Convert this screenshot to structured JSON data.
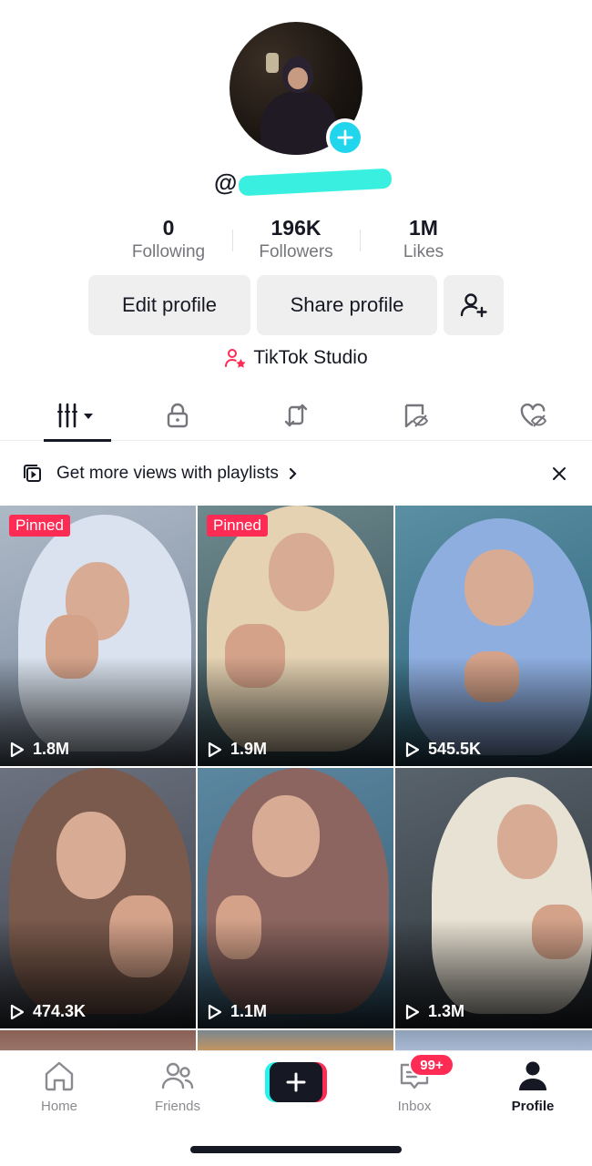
{
  "profile": {
    "username_prefix": "@",
    "stats": [
      {
        "value": "0",
        "label": "Following"
      },
      {
        "value": "196K",
        "label": "Followers"
      },
      {
        "value": "1M",
        "label": "Likes"
      }
    ],
    "edit_label": "Edit profile",
    "share_label": "Share profile",
    "studio_label": "TikTok Studio"
  },
  "banner": {
    "text": "Get more views with playlists"
  },
  "videos": [
    {
      "views": "1.8M",
      "pinned": "Pinned"
    },
    {
      "views": "1.9M",
      "pinned": "Pinned"
    },
    {
      "views": "545.5K"
    },
    {
      "views": "474.3K"
    },
    {
      "views": "1.1M"
    },
    {
      "views": "1.3M"
    }
  ],
  "nav": {
    "home": "Home",
    "friends": "Friends",
    "inbox": "Inbox",
    "inbox_badge": "99+",
    "profile": "Profile"
  },
  "colors": {
    "accent_red": "#fe2c55",
    "accent_cyan": "#25f4ee",
    "avatar_plus": "#20d5ec",
    "text_primary": "#161823",
    "text_secondary": "#75757c"
  }
}
